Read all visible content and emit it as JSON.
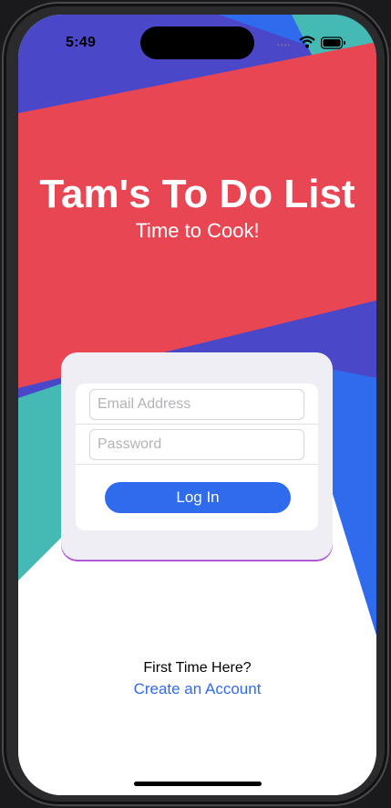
{
  "status_bar": {
    "time": "5:49"
  },
  "header": {
    "title": "Tam's To Do List",
    "subtitle": "Time to Cook!"
  },
  "login_form": {
    "email_placeholder": "Email Address",
    "password_placeholder": "Password",
    "login_label": "Log In"
  },
  "signup": {
    "prompt": "First Time Here?",
    "link_label": "Create an Account"
  },
  "colors": {
    "red": "#E94654",
    "indigo": "#4B47C9",
    "blue": "#2F6BED",
    "teal": "#45B9B3",
    "button_blue": "#2F6BED",
    "card_bg": "#EFEEF4"
  }
}
